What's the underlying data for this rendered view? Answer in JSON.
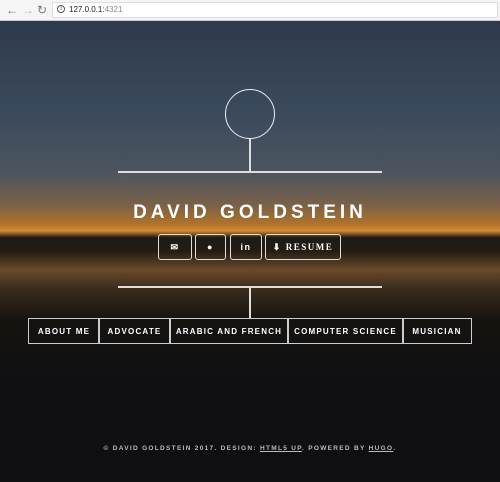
{
  "browser": {
    "url_host": "127.0.0.1:",
    "url_port": "4321",
    "back": "←",
    "forward": "→",
    "reload": "↻",
    "info": "i"
  },
  "header": {
    "name": "DAVID GOLDSTEIN"
  },
  "social": {
    "email_icon": "✉",
    "github_icon": "●",
    "linkedin_icon": "in",
    "resume_icon": "⬇",
    "resume_label": "RESUME"
  },
  "nav": [
    "ABOUT ME",
    "ADVOCATE",
    "ARABIC AND FRENCH",
    "COMPUTER SCIENCE",
    "MUSICIAN"
  ],
  "footer": {
    "prefix": "© DAVID GOLDSTEIN 2017. DESIGN: ",
    "design_link": "HTML5 UP",
    "middle": ". POWERED BY ",
    "powered_link": "HUGO",
    "suffix": "."
  }
}
